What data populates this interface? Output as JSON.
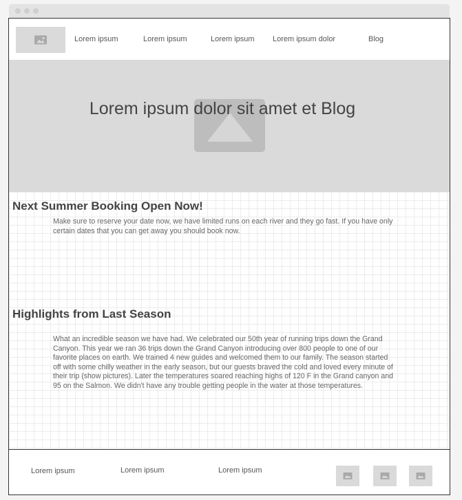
{
  "nav": {
    "logo_icon": "image-placeholder-icon",
    "links": [
      "Lorem ipsum",
      "Lorem ipsum",
      "Lorem ipsum",
      "Lorem ipsum dolor",
      "Blog"
    ]
  },
  "hero": {
    "title": "Lorem ipsum dolor sit amet et Blog",
    "image_icon": "image-placeholder-icon"
  },
  "sections": [
    {
      "title": "Next Summer Booking Open Now!",
      "body": "Make sure to reserve your date now, we have limited runs on each river and they go fast. If you have only certain dates that you can get away you should book now."
    },
    {
      "title": "Highlights from Last Season",
      "body": "What an incredible season we have had. We celebrated our 50th year of running trips down the Grand Canyon. This year we ran 36 trips down the Grand Canyon introducing over 800 people to one of our favorite places on earth. We trained 4 new guides and welcomed them to our family. The season started off with some chilly weather in the early season, but our guests braved the cold and loved every minute of their trip (show pictures). Later the temperatures soared reaching highs of 120 F in the Grand canyon and 95 on the Salmon. We didn't have any trouble getting people in the water at those temperatures."
    }
  ],
  "footer": {
    "links": [
      "Lorem ipsum",
      "Lorem ipsum",
      "Lorem ipsum"
    ],
    "social_icons": [
      "image-placeholder-icon",
      "image-placeholder-icon",
      "image-placeholder-icon"
    ]
  },
  "colors": {
    "placeholder": "#dadada",
    "hero_image": "#bdbdbd",
    "border": "#333333"
  }
}
